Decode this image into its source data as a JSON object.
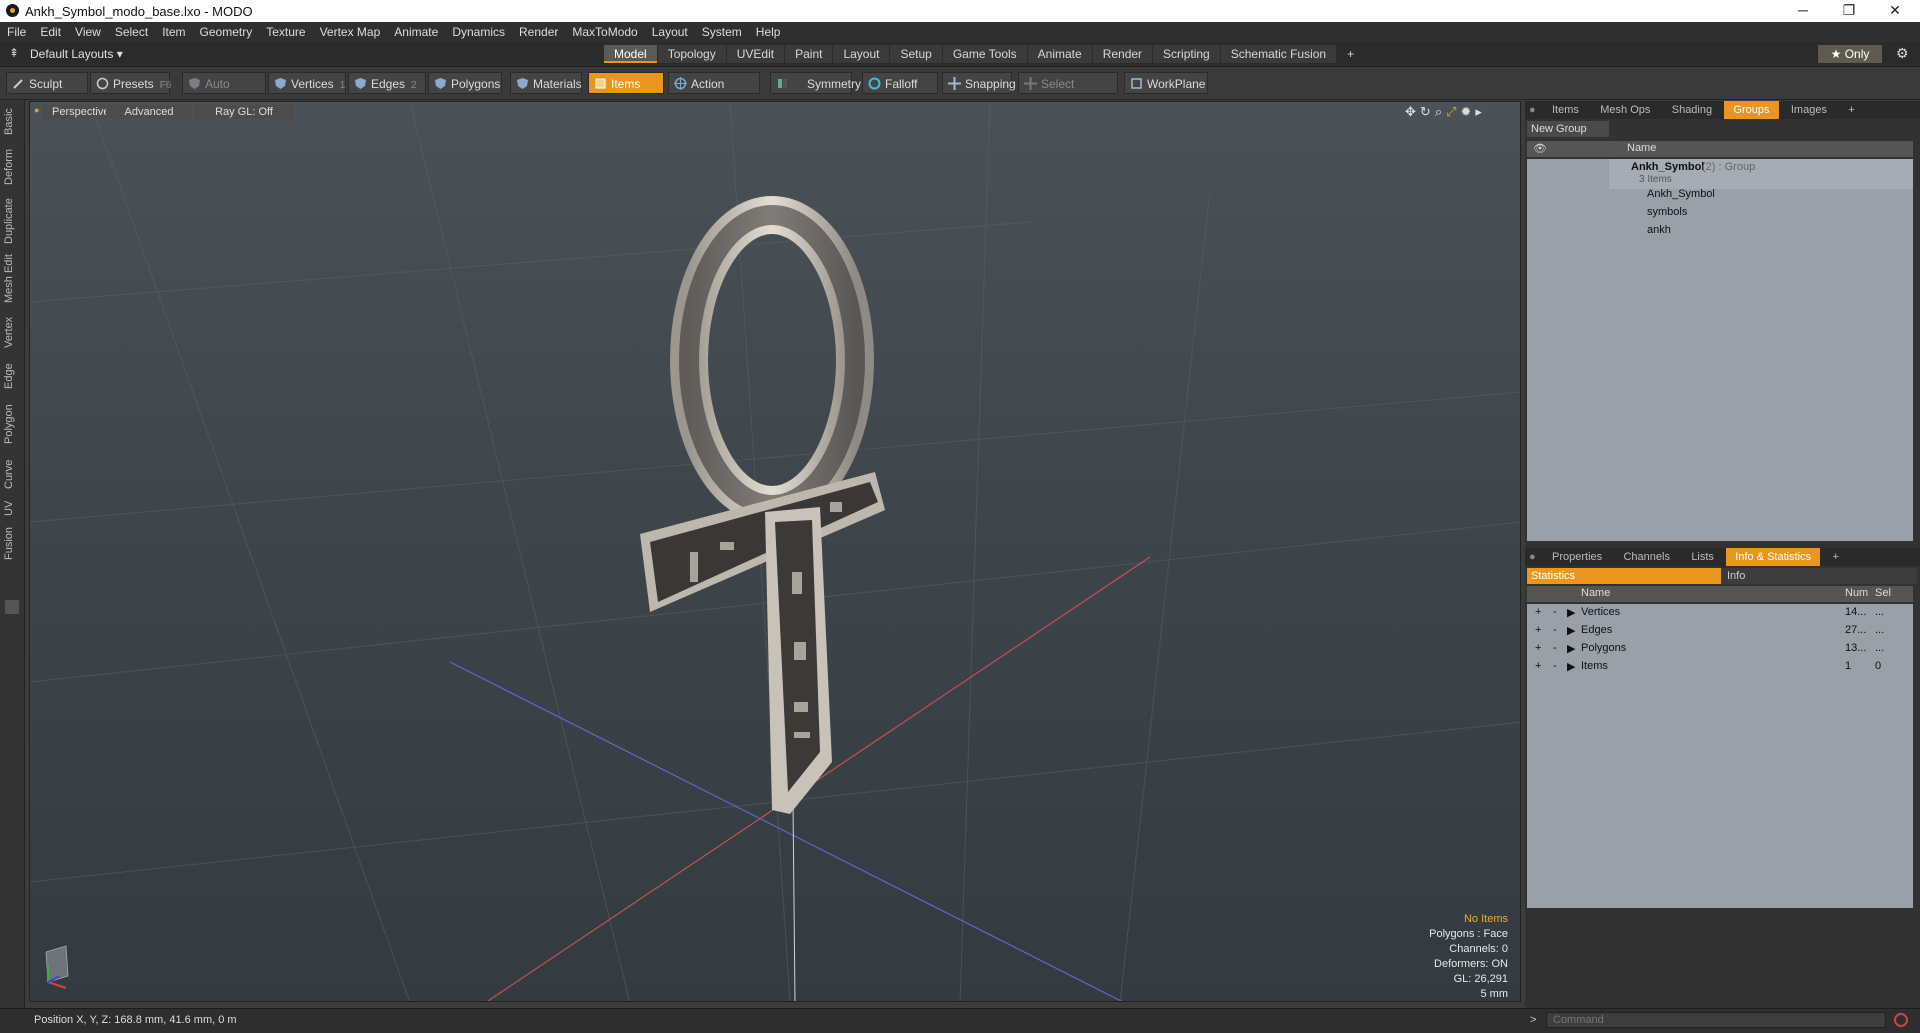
{
  "window": {
    "title": "Ankh_Symbol_modo_base.lxo - MODO",
    "minimize": "─",
    "maximize": "❐",
    "close": "✕"
  },
  "menu": [
    "File",
    "Edit",
    "View",
    "Select",
    "Item",
    "Geometry",
    "Texture",
    "Vertex Map",
    "Animate",
    "Dynamics",
    "Render",
    "MaxToModo",
    "Layout",
    "System",
    "Help"
  ],
  "layoutbar": {
    "layout_label": "Default Layouts ▾",
    "tabs": [
      "Model",
      "Topology",
      "UVEdit",
      "Paint",
      "Layout",
      "Setup",
      "Game Tools",
      "Animate",
      "Render",
      "Scripting",
      "Schematic Fusion",
      "+"
    ],
    "active_tab": "Model",
    "only_label": "★ Only",
    "gear": "⚙"
  },
  "toolbar": {
    "sculpt": "Sculpt",
    "presets": "Presets",
    "presets_key": "F6",
    "auto_select": "Auto Select",
    "vertices": "Vertices",
    "vertices_key": "1",
    "edges": "Edges",
    "edges_key": "2",
    "polygons": "Polygons",
    "materials": "Materials",
    "items": "Items",
    "action_center": "Action Center",
    "symmetry": "Symmetry",
    "falloff": "Falloff",
    "snapping": "Snapping",
    "select_through": "Select Through",
    "workplane": "WorkPlane"
  },
  "left_tabs": [
    "Basic",
    "Deform",
    "Duplicate",
    "Mesh Edit",
    "Vertex",
    "Edge",
    "Polygon",
    "Curve",
    "UV",
    "Fusion"
  ],
  "viewport": {
    "view_mode": "Perspective",
    "shading": "Advanced",
    "raygl": "Ray GL: Off",
    "stats": {
      "items": "No Items",
      "polygons": "Polygons : Face",
      "channels": "Channels: 0",
      "deformers": "Deformers: ON",
      "gl": "GL: 26,291",
      "scale": "5 mm"
    }
  },
  "groups_panel": {
    "tabs": [
      "Items",
      "Mesh Ops",
      "Shading",
      "Groups",
      "Images",
      "+"
    ],
    "active_tab": "Groups",
    "new_group": "New Group",
    "col_name": "Name",
    "group_name": "Ankh_Symbol",
    "group_suffix": "(2) : Group",
    "group_count": "3 Items",
    "children": [
      "Ankh_Symbol",
      "symbols",
      "ankh"
    ]
  },
  "stats_panel": {
    "tabs": [
      "Properties",
      "Channels",
      "Lists",
      "Info & Statistics",
      "+"
    ],
    "active_tab": "Info & Statistics",
    "sub_tabs": [
      "Statistics",
      "Info"
    ],
    "headers": [
      "Name",
      "Num",
      "Sel"
    ],
    "rows": [
      {
        "name": "Vertices",
        "num": "14...",
        "sel": "..."
      },
      {
        "name": "Edges",
        "num": "27...",
        "sel": "..."
      },
      {
        "name": "Polygons",
        "num": "13...",
        "sel": "..."
      },
      {
        "name": "Items",
        "num": "1",
        "sel": "0"
      }
    ]
  },
  "status": {
    "position": "Position X, Y, Z:   168.8 mm, 41.6 mm, 0 m",
    "command_placeholder": "Command",
    "prompt": ">"
  },
  "colors": {
    "accent": "#e8961e",
    "panel": "#323232",
    "viewport_top": "#4a5258"
  }
}
